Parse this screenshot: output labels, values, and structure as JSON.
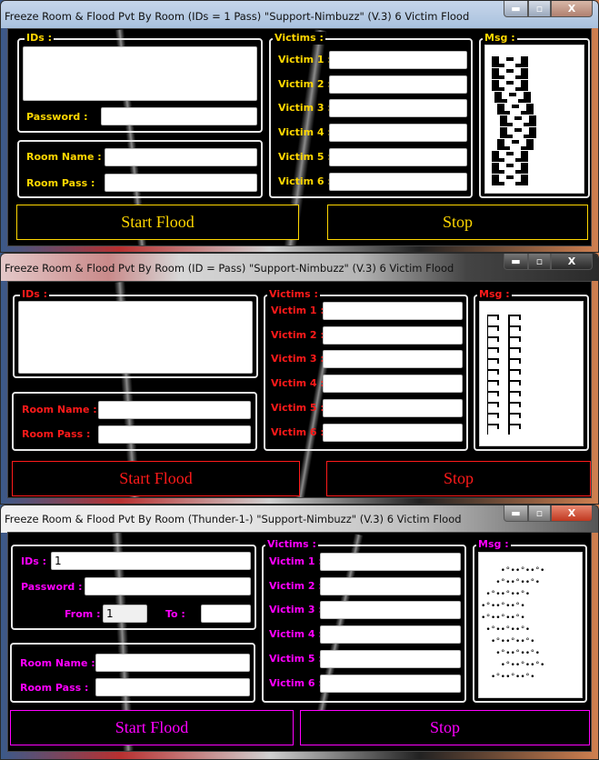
{
  "windows": [
    {
      "title": "Freeze Room & Flood Pvt By Room  (IDs = 1 Pass)  \"Support-Nimbuzz\"   (V.3) 6 Victim Flood",
      "accent": "#ffd700",
      "ids_legend": "IDs :",
      "ids_value": "",
      "password_label": "Password :",
      "password_value": "",
      "room_name_label": "Room Name :",
      "room_pass_label": "Room Pass :",
      "victims_legend": "Victims :",
      "victim_labels": [
        "Victim 1 :",
        "Victim 2 :",
        "Victim 3 :",
        "Victim 4 :",
        "Victim 5 :",
        "Victim 6 :"
      ],
      "msg_legend": "Msg :",
      "msg_pattern": "block-brackets",
      "start_label": "Start Flood",
      "stop_label": "Stop"
    },
    {
      "title": "Freeze Room & Flood Pvt By Room  (ID = Pass)  \"Support-Nimbuzz\"       (V.3) 6 Victim Flood",
      "accent": "#ff1a1a",
      "ids_legend": "IDs :",
      "ids_value": "",
      "room_name_label": "Room Name :",
      "room_pass_label": "Room Pass :",
      "victims_legend": "Victims :",
      "victim_labels": [
        "Victim 1 :",
        "Victim 2 :",
        "Victim 3 :",
        "Victim 4 :",
        "Victim 5 :",
        "Victim 6 :"
      ],
      "msg_legend": "Msg :",
      "msg_pattern": "ladders",
      "start_label": "Start Flood",
      "stop_label": "Stop"
    },
    {
      "title": "Freeze Room & Flood Pvt By Room  (Thunder-1-)  \"Support-Nimbuzz\"   (V.3) 6 Victim Flood",
      "accent": "#ff00ff",
      "ids_label": "IDs :",
      "ids_value": "1",
      "password_label": "Password :",
      "password_value": "",
      "from_label": "From :",
      "from_value": "1",
      "to_label": "To :",
      "to_value": "",
      "room_name_label": "Room Name :",
      "room_pass_label": "Room Pass :",
      "victims_legend": "Victims :",
      "victim_labels": [
        "Victim 1 :",
        "Victim 2 :",
        "Victim 3 :",
        "Victim 4 :",
        "Victim 5 :",
        "Victim 6 :"
      ],
      "msg_legend": "Msg :",
      "msg_lines": [
        "    •°••°••°•",
        "   •°••°••°•",
        " •°••°••°•",
        "•°••°••°•",
        "•°••°••°•",
        " •°••°••°•",
        "  •°••°••°•",
        "   •°••°••°•",
        "    •°••°••°•",
        "  •°••°••°•"
      ],
      "start_label": "Start Flood",
      "stop_label": "Stop"
    }
  ],
  "window_controls": {
    "minimize": "minimize-icon",
    "maximize": "maximize-icon",
    "close": "close-icon",
    "close_glyph": "X"
  }
}
